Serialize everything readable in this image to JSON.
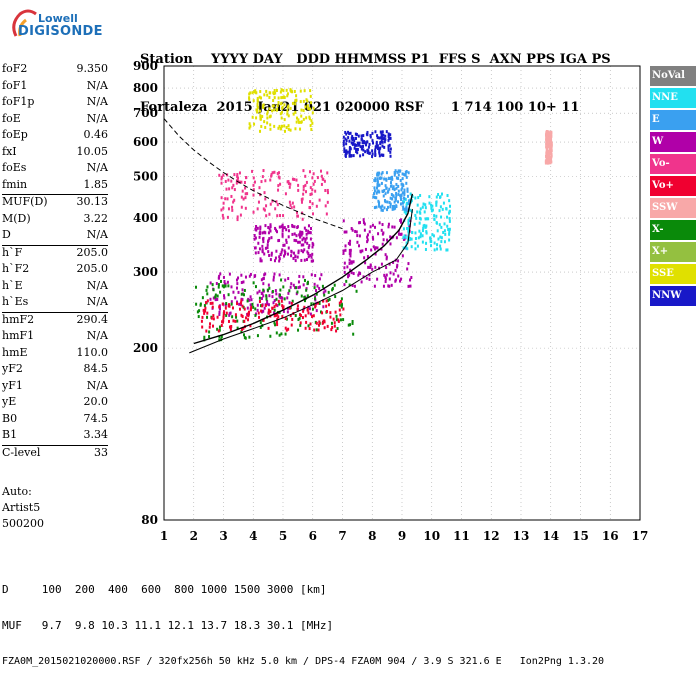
{
  "logo": {
    "line1": "Lowell",
    "line2": "DIGISONDE"
  },
  "header": {
    "line1": "Station    YYYY DAY   DDD HHMMSS P1  FFS S  AXN PPS IGA PS",
    "line2": "Fortaleza  2015 Jan21 021 020000 RSF      1 714 100 10+ 11"
  },
  "params": [
    {
      "k": "foF2",
      "v": "9.350",
      "sep": false
    },
    {
      "k": "foF1",
      "v": "N/A",
      "sep": false
    },
    {
      "k": "foF1p",
      "v": "N/A",
      "sep": false
    },
    {
      "k": "foE",
      "v": "N/A",
      "sep": false
    },
    {
      "k": "foEp",
      "v": "0.46",
      "sep": false
    },
    {
      "k": "fxI",
      "v": "10.05",
      "sep": false
    },
    {
      "k": "foEs",
      "v": "N/A",
      "sep": false
    },
    {
      "k": "fmin",
      "v": "1.85",
      "sep": false
    },
    {
      "k": "MUF(D)",
      "v": "30.13",
      "sep": true
    },
    {
      "k": "M(D)",
      "v": "3.22",
      "sep": false
    },
    {
      "k": "D",
      "v": "N/A",
      "sep": false
    },
    {
      "k": "h`F",
      "v": "205.0",
      "sep": true
    },
    {
      "k": "h`F2",
      "v": "205.0",
      "sep": false
    },
    {
      "k": "h`E",
      "v": "N/A",
      "sep": false
    },
    {
      "k": "h`Es",
      "v": "N/A",
      "sep": false
    },
    {
      "k": "hmF2",
      "v": "290.4",
      "sep": true
    },
    {
      "k": "hmF1",
      "v": "N/A",
      "sep": false
    },
    {
      "k": "hmE",
      "v": "110.0",
      "sep": false
    },
    {
      "k": "yF2",
      "v": "84.5",
      "sep": false
    },
    {
      "k": "yF1",
      "v": "N/A",
      "sep": false
    },
    {
      "k": "yE",
      "v": "20.0",
      "sep": false
    },
    {
      "k": "B0",
      "v": "74.5",
      "sep": false
    },
    {
      "k": "B1",
      "v": "3.34",
      "sep": false
    },
    {
      "k": "C-level",
      "v": "33",
      "sep": true
    }
  ],
  "autoscale": {
    "line1": "Auto:",
    "line2": "Artist5",
    "line3": "500200"
  },
  "legend": [
    {
      "label": "NoVal",
      "color": "#808080"
    },
    {
      "label": "NNE",
      "color": "#22e0f0"
    },
    {
      "label": "E",
      "color": "#3aa0f0"
    },
    {
      "label": "W",
      "color": "#b000a8"
    },
    {
      "label": "Vo-",
      "color": "#f0348c"
    },
    {
      "label": "Vo+",
      "color": "#f00030"
    },
    {
      "label": "SSW",
      "color": "#f8a8a8"
    },
    {
      "label": "X-",
      "color": "#0a8a0a"
    },
    {
      "label": "X+",
      "color": "#94c040"
    },
    {
      "label": "SSE",
      "color": "#e0e000"
    },
    {
      "label": "NNW",
      "color": "#1818c8"
    }
  ],
  "footer": {
    "d_line": "D     100  200  400  600  800 1000 1500 3000 [km]",
    "muf_line": "MUF   9.7  9.8 10.3 11.1 12.1 13.7 18.3 30.1 [MHz]",
    "source_line": "FZA0M_2015021020000.RSF / 320fx256h 50 kHz 5.0 km / DPS-4 FZA0M 904 / 3.9 S 321.6 E   Ion2Png 1.3.20"
  },
  "chart_data": {
    "type": "scatter",
    "title": "",
    "xlabel": "",
    "ylabel": "",
    "xlim": [
      1,
      17
    ],
    "ylim": [
      80,
      900
    ],
    "y_axis_scale": "logarithmic",
    "x_ticks": [
      1,
      2,
      3,
      4,
      5,
      6,
      7,
      8,
      9,
      10,
      11,
      12,
      13,
      14,
      15,
      16,
      17
    ],
    "y_ticks": [
      80,
      200,
      300,
      400,
      500,
      600,
      700,
      800,
      900
    ],
    "grid": "dotted",
    "legend_position": "right",
    "profile_curve": {
      "name": "",
      "x": [
        1.85,
        3.0,
        4.0,
        5.0,
        6.0,
        7.0,
        8.0,
        8.8,
        9.2,
        9.35
      ],
      "y": [
        195,
        210,
        222,
        235,
        252,
        272,
        300,
        320,
        350,
        420
      ]
    },
    "virtual_height_trace": {
      "x": [
        2.0,
        3.0,
        4.0,
        5.0,
        6.0,
        7.0,
        7.8,
        8.4,
        8.9,
        9.2,
        9.35
      ],
      "y": [
        205,
        215,
        228,
        245,
        265,
        292,
        320,
        345,
        375,
        410,
        455
      ]
    },
    "dashed_curve": {
      "x": [
        1.0,
        1.5,
        2.0,
        2.5,
        3.0,
        3.5,
        4.0,
        5.0,
        6.0,
        7.0
      ],
      "y": [
        680,
        620,
        575,
        540,
        510,
        485,
        463,
        428,
        400,
        378
      ]
    },
    "echo_clusters": [
      {
        "name": "W",
        "x": [
          2.5,
          6.5
        ],
        "y": [
          240,
          300
        ]
      },
      {
        "name": "W",
        "x": [
          7.0,
          9.3
        ],
        "y": [
          280,
          400
        ]
      },
      {
        "name": "W",
        "x": [
          4.0,
          6.0
        ],
        "y": [
          320,
          390
        ]
      },
      {
        "name": "NNE",
        "x": [
          9.0,
          10.6
        ],
        "y": [
          340,
          460
        ]
      },
      {
        "name": "E",
        "x": [
          8.0,
          9.2
        ],
        "y": [
          420,
          520
        ]
      },
      {
        "name": "NNW",
        "x": [
          7.0,
          8.6
        ],
        "y": [
          560,
          640
        ]
      },
      {
        "name": "SSE",
        "x": [
          3.8,
          6.0
        ],
        "y": [
          640,
          800
        ]
      },
      {
        "name": "X-",
        "x": [
          2.0,
          7.5
        ],
        "y": [
          210,
          290
        ]
      },
      {
        "name": "Vo+",
        "x": [
          2.2,
          7.0
        ],
        "y": [
          220,
          260
        ]
      },
      {
        "name": "Vo-",
        "x": [
          2.8,
          6.5
        ],
        "y": [
          400,
          520
        ]
      },
      {
        "name": "SSW",
        "x": [
          13.8,
          14.0
        ],
        "y": [
          540,
          640
        ]
      }
    ]
  }
}
